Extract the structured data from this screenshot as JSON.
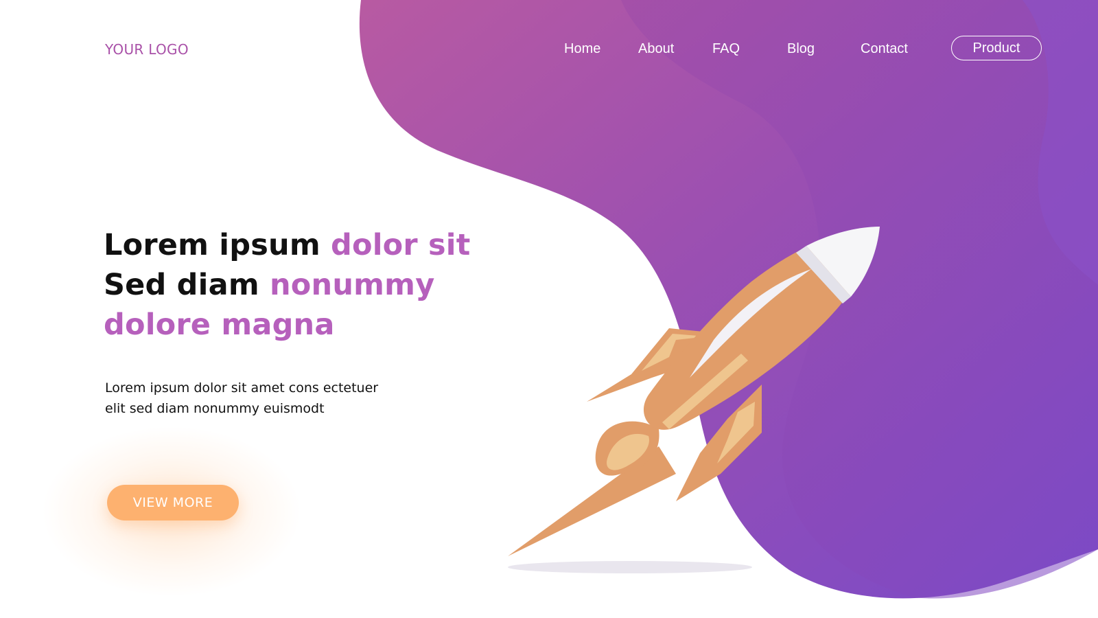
{
  "header": {
    "logo": "YOUR LOGO",
    "nav": {
      "home": "Home",
      "about": "About",
      "faq": "FAQ",
      "blog": "Blog",
      "contact": "Contact",
      "product": "Product"
    }
  },
  "hero": {
    "title": {
      "line1_plain": "Lorem ipsum ",
      "line1_accent": "dolor sit",
      "line2_plain": "Sed diam ",
      "line2_accent": "nonummy",
      "line3_accent": "dolore magna"
    },
    "text_line1": "Lorem ipsum dolor sit amet cons ectetuer",
    "text_line2": "elit sed diam nonummy euismodt",
    "cta_label": "VIEW MORE"
  },
  "illustration": {
    "icon": "rocket-icon"
  },
  "colors": {
    "accent": "#b660bc",
    "logo": "#a951a8",
    "gradient_start": "#b85aa2",
    "gradient_end": "#7b4ac6",
    "cta": "#fdb16f",
    "rocket_body": "#e19d69",
    "rocket_light": "#efc58e",
    "rocket_tip": "#f6f6f8"
  }
}
